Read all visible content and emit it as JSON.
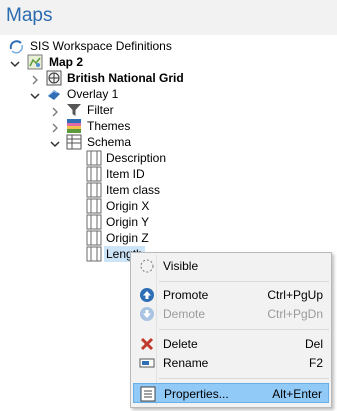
{
  "window": {
    "title": "Maps"
  },
  "tree": {
    "root": "SIS Workspace Definitions",
    "map": "Map 2",
    "grid": "British National Grid",
    "overlay": "Overlay 1",
    "filter": "Filter",
    "themes": "Themes",
    "schema": "Schema",
    "fields": [
      "Description",
      "Item ID",
      "Item class",
      "Origin X",
      "Origin Y",
      "Origin Z",
      "Length"
    ]
  },
  "context_menu": {
    "items": [
      {
        "label": "Visible",
        "shortcut": "",
        "icon": "visible-dotted-circle-icon",
        "disabled": false
      },
      {
        "label": "Promote",
        "shortcut": "Ctrl+PgUp",
        "icon": "promote-arrow-up-icon",
        "disabled": false
      },
      {
        "label": "Demote",
        "shortcut": "Ctrl+PgDn",
        "icon": "demote-arrow-down-icon",
        "disabled": true
      },
      {
        "label": "Delete",
        "shortcut": "Del",
        "icon": "delete-x-icon",
        "disabled": false
      },
      {
        "label": "Rename",
        "shortcut": "F2",
        "icon": "rename-icon",
        "disabled": false
      },
      {
        "label": "Properties...",
        "shortcut": "Alt+Enter",
        "icon": "properties-icon",
        "disabled": false,
        "highlighted": true
      }
    ]
  },
  "colors": {
    "title_text": "#2b6cb0",
    "selection": "#cce4f7",
    "menu_highlight": "#91c9f7",
    "delete_red": "#c0392b",
    "promote_blue": "#2f6db5"
  }
}
